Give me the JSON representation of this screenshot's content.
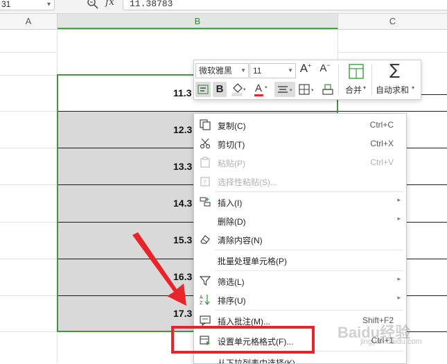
{
  "formula_bar": {
    "name_box": "31",
    "fx": "fx",
    "formula": "11.38783"
  },
  "columns": [
    "A",
    "B",
    "C"
  ],
  "cells": [
    "11.3",
    "12.3",
    "13.3",
    "14.3",
    "15.3",
    "16.3",
    "17.3"
  ],
  "mini_toolbar": {
    "font_name": "微软雅黑",
    "font_size": "11",
    "grow_font": "A",
    "shrink_font": "A",
    "bold": "B",
    "font_color": "A",
    "merge_label": "合并",
    "autosum_label": "自动求和",
    "sigma": "∑"
  },
  "context_menu": [
    {
      "label": "复制(C)",
      "shortcut": "Ctrl+C",
      "icon": "copy-icon",
      "enabled": true
    },
    {
      "label": "剪切(T)",
      "shortcut": "Ctrl+X",
      "icon": "scissors-icon",
      "enabled": true
    },
    {
      "label": "粘贴(P)",
      "shortcut": "Ctrl+V",
      "icon": "paste-icon",
      "enabled": false
    },
    {
      "label": "选择性粘贴(S)...",
      "shortcut": "",
      "icon": "paste-special-icon",
      "enabled": false
    },
    {
      "label": "插入(I)",
      "shortcut": "",
      "icon": "insert-icon",
      "submenu": true,
      "enabled": true
    },
    {
      "label": "删除(D)",
      "shortcut": "",
      "icon": "",
      "submenu": true,
      "enabled": true
    },
    {
      "label": "清除内容(N)",
      "shortcut": "",
      "icon": "eraser-icon",
      "enabled": true
    },
    {
      "label": "批量处理单元格(P)",
      "shortcut": "",
      "icon": "",
      "enabled": true
    },
    {
      "label": "筛选(L)",
      "shortcut": "",
      "icon": "filter-icon",
      "submenu": true,
      "enabled": true
    },
    {
      "label": "排序(U)",
      "shortcut": "",
      "icon": "sort-icon",
      "submenu": true,
      "enabled": true
    },
    {
      "label": "插入批注(M)...",
      "shortcut": "Shift+F2",
      "icon": "comment-icon",
      "enabled": true
    },
    {
      "label": "设置单元格格式(F)...",
      "shortcut": "Ctrl+1",
      "icon": "format-cells-icon",
      "enabled": true
    },
    {
      "label": "从下拉列表中选择(K)...",
      "shortcut": "",
      "icon": "",
      "enabled": true
    }
  ],
  "watermark": "Baidu经验",
  "watermark_sub": "jingyan.baidu.com",
  "colors": {
    "selection_border": "#3c9a3c",
    "highlight": "#e8242b",
    "selection_fill": "#d9d9d9"
  }
}
